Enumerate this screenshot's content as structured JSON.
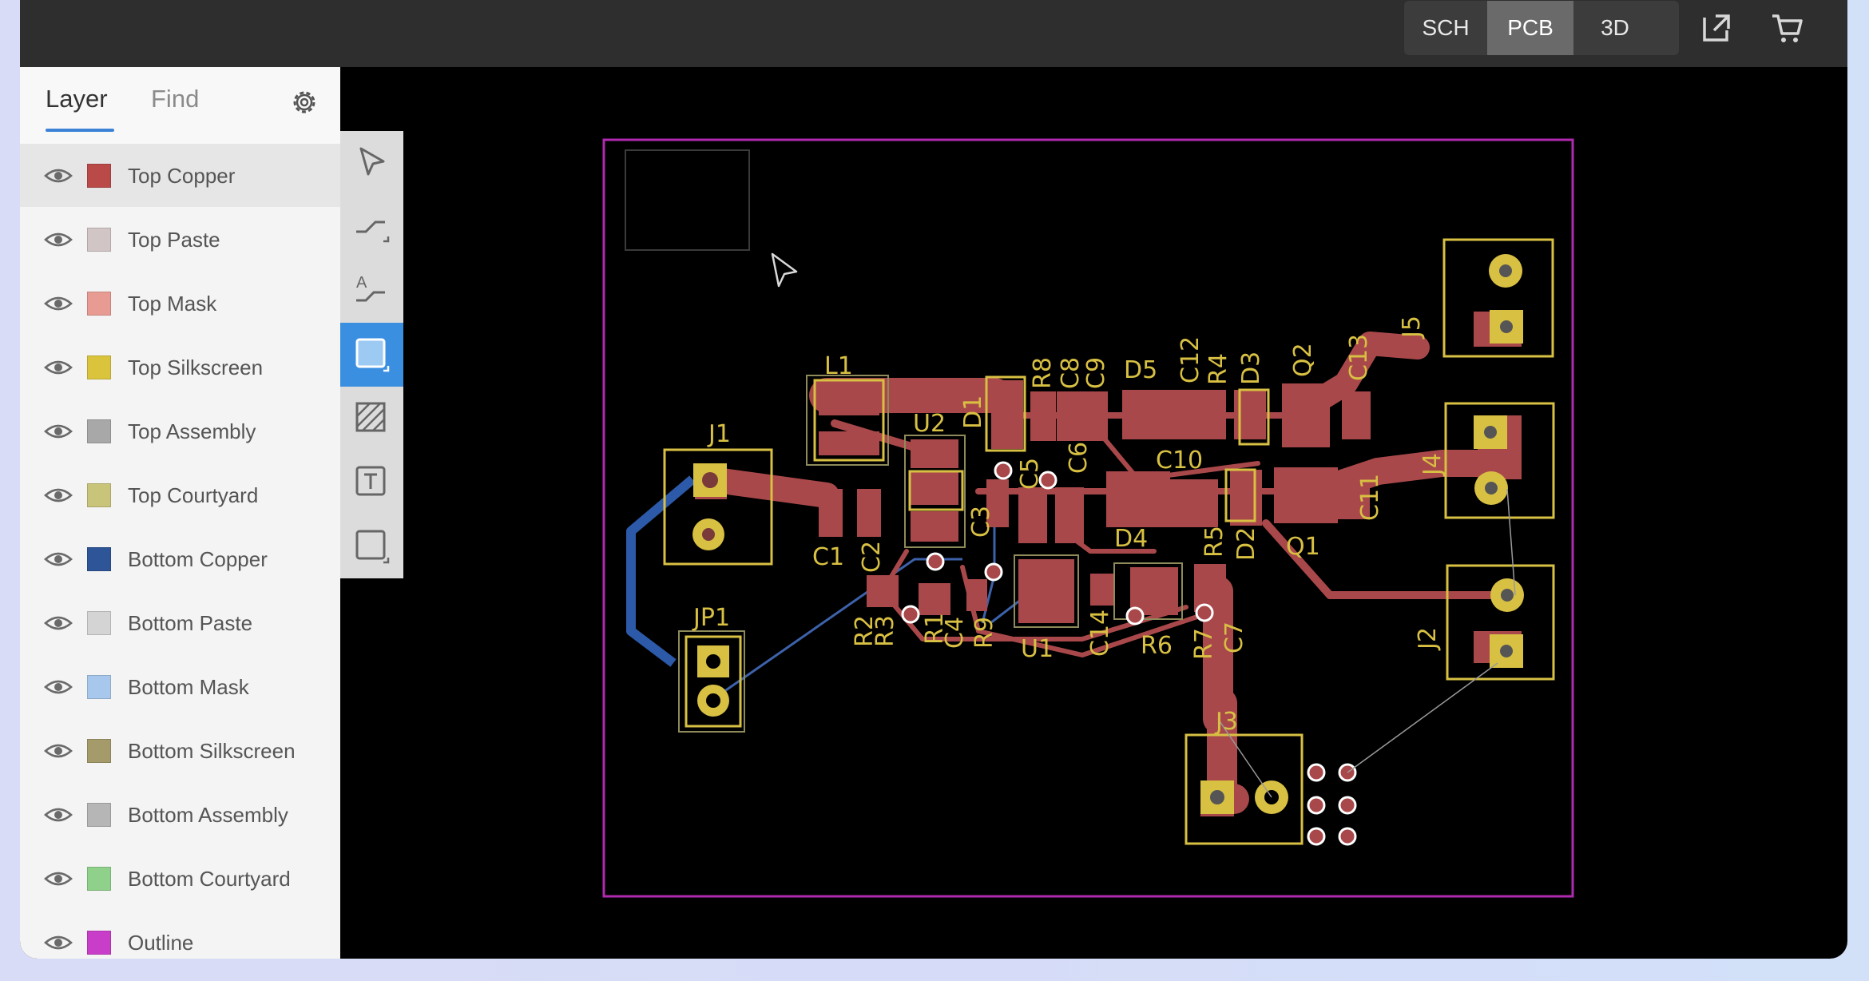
{
  "topbar": {
    "views": [
      {
        "label": "SCH",
        "active": false
      },
      {
        "label": "PCB",
        "active": true
      },
      {
        "label": "3D",
        "active": false
      }
    ],
    "icons": [
      "open-external-icon",
      "cart-icon"
    ]
  },
  "panel": {
    "tabs": [
      "Layer",
      "Find"
    ],
    "active_tab": "Layer",
    "settings_icon": "gear-icon",
    "layers": [
      {
        "name": "Top Copper",
        "color": "#b94a48",
        "selected": true
      },
      {
        "name": "Top Paste",
        "color": "#d2c5c5"
      },
      {
        "name": "Top Mask",
        "color": "#e89b92"
      },
      {
        "name": "Top Silkscreen",
        "color": "#d9c43c"
      },
      {
        "name": "Top Assembly",
        "color": "#a8a8a8"
      },
      {
        "name": "Top Courtyard",
        "color": "#c8c47a"
      },
      {
        "name": "Bottom Copper",
        "color": "#2e5597"
      },
      {
        "name": "Bottom Paste",
        "color": "#d4d4d4"
      },
      {
        "name": "Bottom Mask",
        "color": "#a7c8ec"
      },
      {
        "name": "Bottom Silkscreen",
        "color": "#a59a6a"
      },
      {
        "name": "Bottom Assembly",
        "color": "#b6b6b6"
      },
      {
        "name": "Bottom Courtyard",
        "color": "#8fd08a"
      },
      {
        "name": "Outline",
        "color": "#c93ec9"
      }
    ]
  },
  "tools": [
    {
      "name": "select-tool",
      "icon": "pointer-icon",
      "active": false
    },
    {
      "name": "route-tool",
      "icon": "route-track-icon",
      "active": false
    },
    {
      "name": "text-route-tool",
      "icon": "route-label-icon",
      "active": false
    },
    {
      "name": "rectangle-tool",
      "icon": "rectangle-icon",
      "active": true
    },
    {
      "name": "hatch-tool",
      "icon": "hatch-fill-icon",
      "active": false
    },
    {
      "name": "text-tool",
      "icon": "text-icon",
      "active": false
    },
    {
      "name": "shape-tool",
      "icon": "square-outline-icon",
      "active": false
    }
  ],
  "pcb": {
    "designators": [
      "L1",
      "J1",
      "JP1",
      "C1",
      "C2",
      "U2",
      "D1",
      "R8",
      "C8",
      "C9",
      "D5",
      "C12",
      "R4",
      "D3",
      "Q2",
      "C13",
      "J5",
      "C10",
      "C3",
      "C5",
      "C6",
      "D4",
      "R5",
      "D2",
      "Q1",
      "C11",
      "J4",
      "R2",
      "R3",
      "R1",
      "C4",
      "R9",
      "U1",
      "C14",
      "R6",
      "R7",
      "C7",
      "J2",
      "J3"
    ],
    "colors": {
      "copper": "#a9484a",
      "silkscreen": "#d8c043",
      "outline": "#b02ab0",
      "bottom_copper": "#2d5aa8",
      "ratsnest": "#9a9a9a"
    }
  }
}
